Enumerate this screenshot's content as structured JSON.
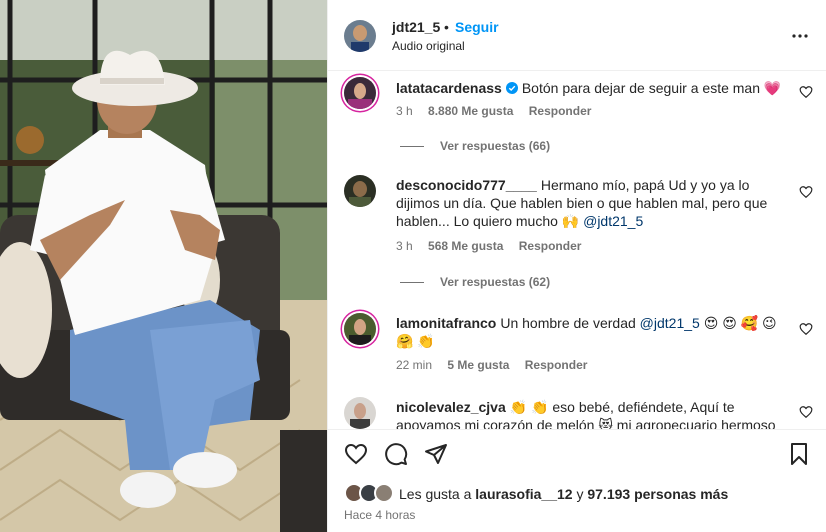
{
  "post": {
    "username": "jdt21_5",
    "separator": "•",
    "follow_label": "Seguir",
    "audio": "Audio original"
  },
  "comments": [
    {
      "username": "latatacardenass",
      "verified": true,
      "text": "Botón para dejar de seguir a este man 💗",
      "time": "3 h",
      "likes": "8.880 Me gusta",
      "reply_label": "Responder",
      "view_replies": "Ver respuestas (66)"
    },
    {
      "username": "desconocido777____",
      "text": "Hermano mío, papá Ud y yo ya lo dijimos un día. Que hablen bien o que hablen mal, pero que hablen... Lo quiero mucho 🙌",
      "mention": "@jdt21_5",
      "time": "3 h",
      "likes": "568 Me gusta",
      "reply_label": "Responder",
      "view_replies": "Ver respuestas (62)"
    },
    {
      "username": "lamonitafranco",
      "text": "Un hombre de verdad",
      "mention": "@jdt21_5",
      "emoji": "😍 😍 🥰 😉 🤗 👏",
      "time": "22 min",
      "likes": "5 Me gusta",
      "reply_label": "Responder"
    },
    {
      "username": "nicolevalez_cjva",
      "text": "👏 👏 eso bebé, defiéndete, Aquí te apoyamos mi corazón de melón 😻 mi agropecuario hermoso"
    }
  ],
  "likes_summary": {
    "prefix": "Les gusta a",
    "user": "laurasofia__12",
    "joiner": "y",
    "others": "97.193 personas más"
  },
  "timestamp": "Hace 4 horas",
  "icons": {
    "more": "more-horizontal-icon",
    "like": "heart-icon",
    "comment": "comment-icon",
    "share": "send-icon",
    "save": "bookmark-icon",
    "verified": "verified-badge-icon"
  },
  "colors": {
    "accent": "#0095f6",
    "text": "#262626",
    "muted": "#737373",
    "mention": "#00376b",
    "heart": "#ed4956"
  }
}
